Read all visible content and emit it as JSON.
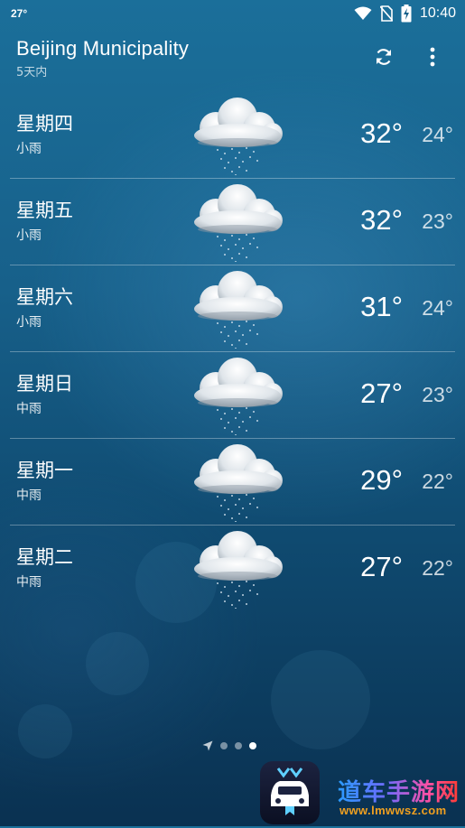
{
  "status_bar": {
    "temperature": "27°",
    "time": "10:40",
    "icons": [
      "wifi-icon",
      "no-sim-icon",
      "battery-charging-icon"
    ]
  },
  "header": {
    "location": "Beijing Municipality",
    "subtitle": "5天内",
    "actions": [
      "refresh-icon",
      "more-vert-icon"
    ]
  },
  "forecast": [
    {
      "day": "星期四",
      "condition": "小雨",
      "high": "32°",
      "low": "24°",
      "icon": "light-rain-icon"
    },
    {
      "day": "星期五",
      "condition": "小雨",
      "high": "32°",
      "low": "23°",
      "icon": "light-rain-icon"
    },
    {
      "day": "星期六",
      "condition": "小雨",
      "high": "31°",
      "low": "24°",
      "icon": "light-rain-icon"
    },
    {
      "day": "星期日",
      "condition": "中雨",
      "high": "27°",
      "low": "23°",
      "icon": "moderate-rain-icon"
    },
    {
      "day": "星期一",
      "condition": "中雨",
      "high": "29°",
      "low": "22°",
      "icon": "moderate-rain-icon"
    },
    {
      "day": "星期二",
      "condition": "中雨",
      "high": "27°",
      "low": "22°",
      "icon": "moderate-rain-icon"
    }
  ],
  "page_indicator": {
    "pages": 4,
    "active_index": 3,
    "first_icon": "location-arrow-icon"
  },
  "watermark": {
    "name": "道车手游网",
    "url": "www.lmwwsz.com"
  },
  "colors": {
    "background_top": "#1b6f9a",
    "background_bottom": "#0a3151",
    "divider": "rgba(255,255,255,0.32)"
  }
}
